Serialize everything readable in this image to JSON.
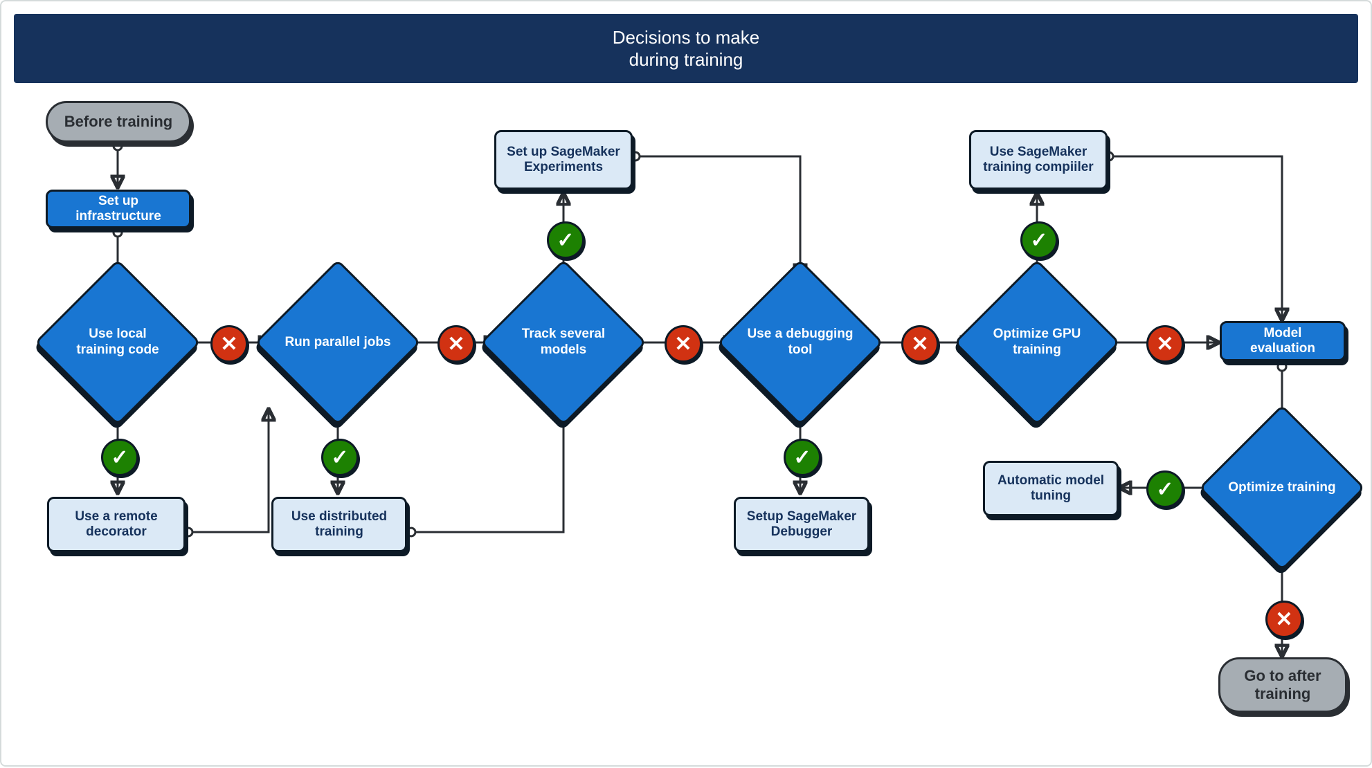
{
  "banner": {
    "line1": "Decisions to make",
    "line2": "during training"
  },
  "nodes": {
    "before": {
      "label": "Before training"
    },
    "setup": {
      "label": "Set up infrastructure"
    },
    "d1": {
      "label": "Use local training code"
    },
    "a1": {
      "label": "Use a remote decorator"
    },
    "d2": {
      "label": "Run parallel jobs"
    },
    "a2": {
      "label": "Use distributed training"
    },
    "d3": {
      "label": "Track several models"
    },
    "a3": {
      "label": "Set up SageMaker Experiments"
    },
    "d4": {
      "label": "Use a debugging tool"
    },
    "a4": {
      "label": "Setup SageMaker Debugger"
    },
    "d5": {
      "label": "Optimize GPU training"
    },
    "a5": {
      "label": "Use SageMaker training compiiler"
    },
    "eval": {
      "label": "Model evaluation"
    },
    "d6": {
      "label": "Optimize training"
    },
    "a6": {
      "label": "Automatic model tuning"
    },
    "after": {
      "label": "Go to after training"
    }
  },
  "chart_data": {
    "type": "flowchart",
    "title": "Decisions to make during training",
    "shapes": {
      "terminator": [
        "before",
        "after"
      ],
      "process_blue": [
        "setup",
        "eval"
      ],
      "process_light": [
        "a1",
        "a2",
        "a3",
        "a4",
        "a5",
        "a6"
      ],
      "decision": [
        "d1",
        "d2",
        "d3",
        "d4",
        "d5",
        "d6"
      ]
    },
    "edges": [
      {
        "from": "before",
        "to": "setup"
      },
      {
        "from": "setup",
        "to": "d1"
      },
      {
        "from": "d1",
        "to": "a1",
        "label": "yes"
      },
      {
        "from": "d1",
        "to": "d2",
        "label": "no"
      },
      {
        "from": "a1",
        "to": "d2"
      },
      {
        "from": "d2",
        "to": "a2",
        "label": "yes"
      },
      {
        "from": "d2",
        "to": "d3",
        "label": "no"
      },
      {
        "from": "a2",
        "to": "d3"
      },
      {
        "from": "d3",
        "to": "a3",
        "label": "yes"
      },
      {
        "from": "a3",
        "to": "d4"
      },
      {
        "from": "d3",
        "to": "d4",
        "label": "no"
      },
      {
        "from": "d4",
        "to": "a4",
        "label": "yes"
      },
      {
        "from": "d4",
        "to": "d5",
        "label": "no"
      },
      {
        "from": "d5",
        "to": "a5",
        "label": "yes"
      },
      {
        "from": "d5",
        "to": "eval",
        "label": "no"
      },
      {
        "from": "a5",
        "to": "eval"
      },
      {
        "from": "eval",
        "to": "d6"
      },
      {
        "from": "d6",
        "to": "a6",
        "label": "yes"
      },
      {
        "from": "d6",
        "to": "after",
        "label": "no"
      }
    ]
  }
}
